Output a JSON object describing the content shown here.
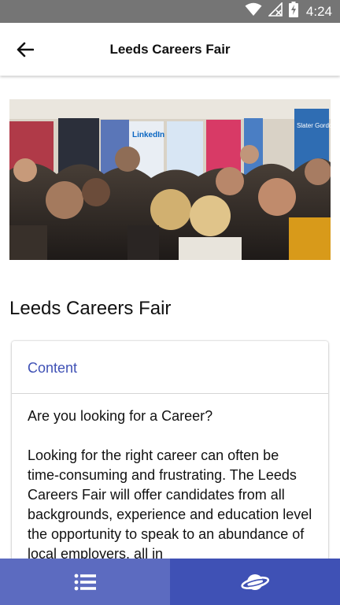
{
  "status_bar": {
    "time": "4:24",
    "icons": [
      "wifi-icon",
      "no-signal-icon",
      "battery-charging-icon"
    ]
  },
  "app_bar": {
    "title": "Leeds Careers Fair",
    "back_icon": "arrow-left-icon"
  },
  "hero_image": {
    "banner_texts": [
      "LinkedIn",
      "Slater Gordon"
    ]
  },
  "page": {
    "title": "Leeds Careers Fair"
  },
  "content_card": {
    "header": "Content",
    "paragraphs": [
      "Are you looking for a Career?",
      "Looking for the right career can often be time-consuming and frustrating. The Leeds Careers Fair will offer candidates from all backgrounds, experience and education level the opportunity to speak to an abundance of local employers, all in"
    ]
  },
  "bottom_nav": {
    "tabs": [
      {
        "icon": "list-icon"
      },
      {
        "icon": "planet-icon"
      }
    ]
  },
  "colors": {
    "primary": "#3f51b5",
    "primary_light": "#5c6bc0",
    "status_bar": "#757575"
  }
}
